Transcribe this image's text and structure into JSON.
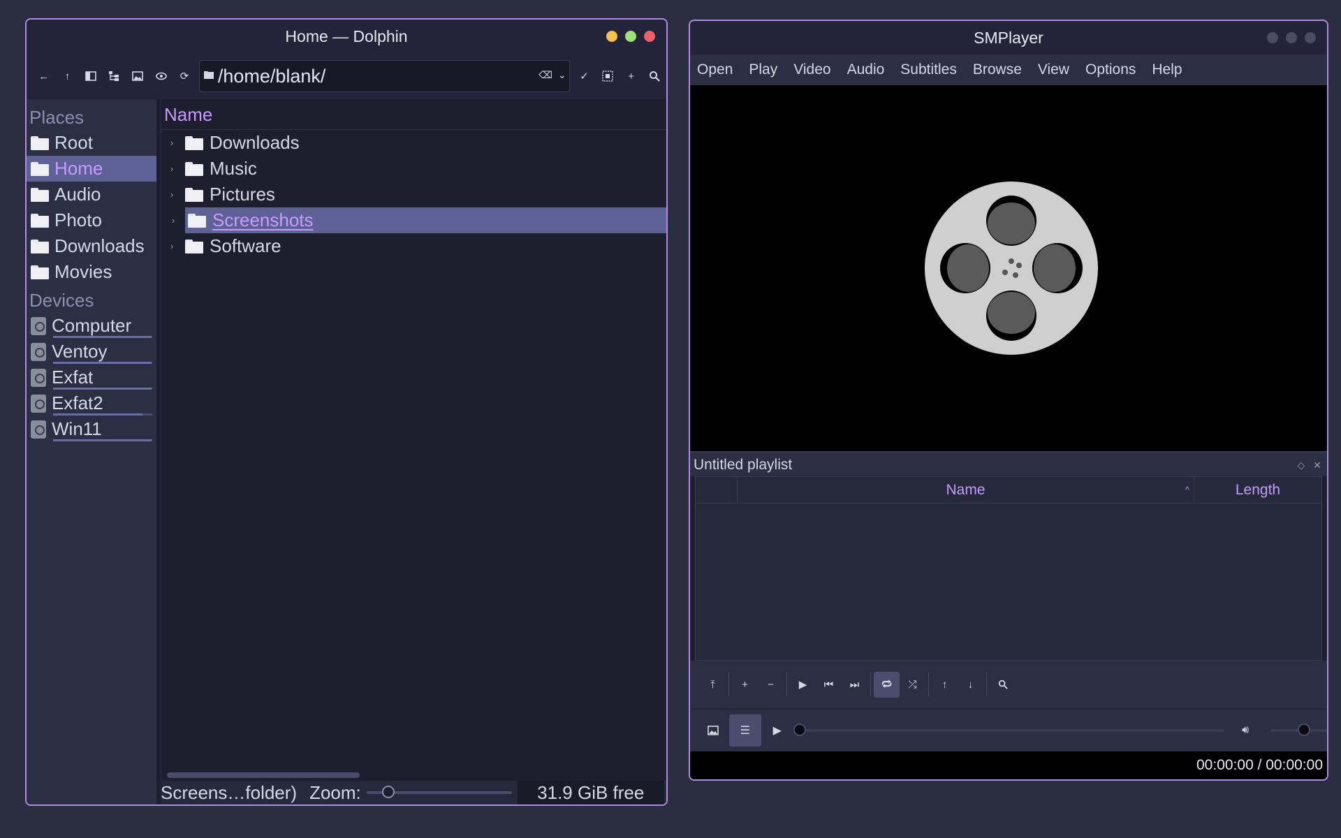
{
  "dolphin": {
    "title": "Home — Dolphin",
    "path": "/home/blank/",
    "places_header": "Places",
    "places": [
      {
        "label": "Root"
      },
      {
        "label": "Home",
        "selected": true
      },
      {
        "label": "Audio"
      },
      {
        "label": "Photo"
      },
      {
        "label": "Downloads"
      },
      {
        "label": "Movies"
      }
    ],
    "devices_header": "Devices",
    "devices": [
      {
        "label": "Computer",
        "usage": 0.99
      },
      {
        "label": "Ventoy",
        "usage": 0.99
      },
      {
        "label": "Exfat",
        "usage": 0.99
      },
      {
        "label": "Exfat2",
        "usage": 0.9
      },
      {
        "label": "Win11",
        "usage": 0.99
      }
    ],
    "column_name": "Name",
    "files": [
      {
        "name": "Downloads"
      },
      {
        "name": "Music"
      },
      {
        "name": "Pictures"
      },
      {
        "name": "Screenshots",
        "selected": true
      },
      {
        "name": "Software"
      }
    ],
    "status_text": "Screens…folder)",
    "zoom_label": "Zoom:",
    "free_space": "31.9 GiB free",
    "colors": {
      "accent": "#c79bff",
      "selection": "#5e6196",
      "border": "#b28be0"
    }
  },
  "smplayer": {
    "title": "SMPlayer",
    "menu": [
      "Open",
      "Play",
      "Video",
      "Audio",
      "Subtitles",
      "Browse",
      "View",
      "Options",
      "Help"
    ],
    "playlist_title": "Untitled playlist",
    "playlist_columns": {
      "name": "Name",
      "length": "Length"
    },
    "time": "00:00:00 / 00:00:00"
  }
}
